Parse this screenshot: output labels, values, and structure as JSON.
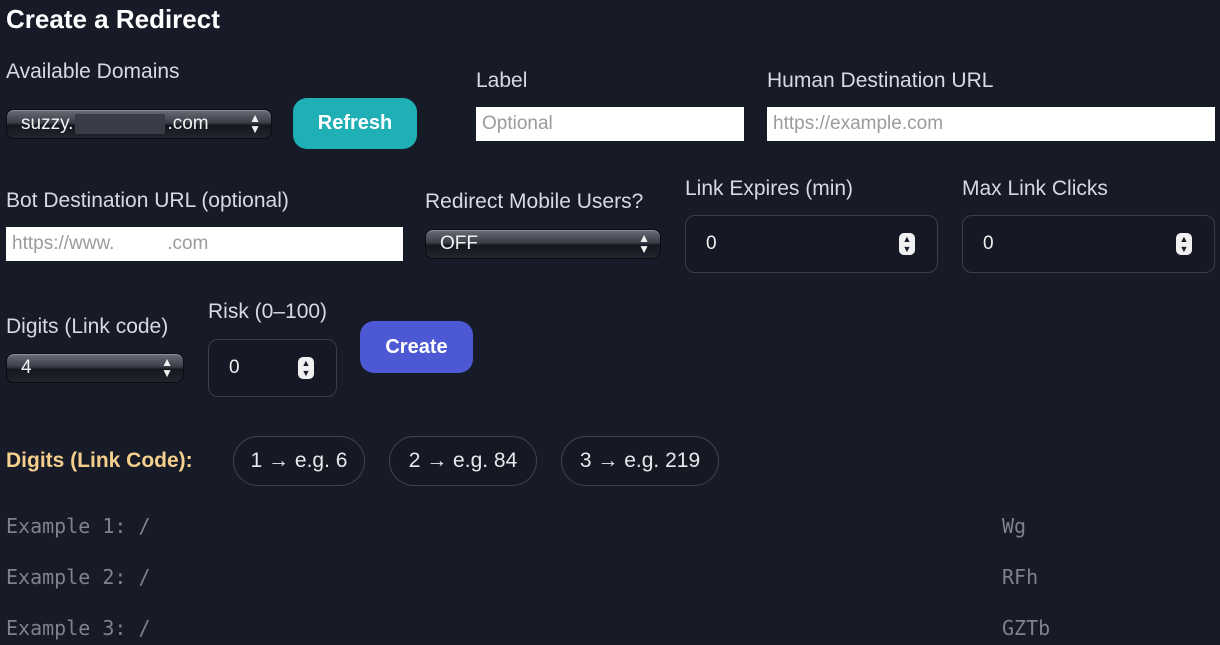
{
  "page": {
    "title": "Create a Redirect"
  },
  "domains": {
    "label": "Available Domains",
    "selected_prefix": "suzzy.",
    "selected_suffix": ".com",
    "refresh_label": "Refresh"
  },
  "label_field": {
    "label": "Label",
    "placeholder": "Optional"
  },
  "human_url": {
    "label": "Human Destination URL",
    "placeholder": "https://example.com"
  },
  "bot_url": {
    "label": "Bot Destination URL (optional)",
    "placeholder": "https://www.          .com"
  },
  "mobile": {
    "label": "Redirect Mobile Users?",
    "selected": "OFF"
  },
  "expires": {
    "label": "Link Expires (min)",
    "value": "0"
  },
  "max_clicks": {
    "label": "Max Link Clicks",
    "value": "0"
  },
  "digits": {
    "label": "Digits (Link code)",
    "selected": "4"
  },
  "risk": {
    "label": "Risk (0–100)",
    "value": "0"
  },
  "create_label": "Create",
  "digits_help": {
    "label": "Digits (Link Code):",
    "chips": [
      "1 → e.g. 6",
      "2 → e.g. 84",
      "3 → e.g. 219"
    ]
  },
  "examples": [
    {
      "prefix": "Example 1: /",
      "suffix": "Wg"
    },
    {
      "prefix": "Example 2: /",
      "suffix": "RFh"
    },
    {
      "prefix": "Example 3: /",
      "suffix": "GZTb"
    }
  ],
  "colors": {
    "background": "#171a27",
    "refresh_button": "#1fb0b6",
    "create_button": "#4d59d4",
    "digits_label": "#f5cf8d"
  }
}
